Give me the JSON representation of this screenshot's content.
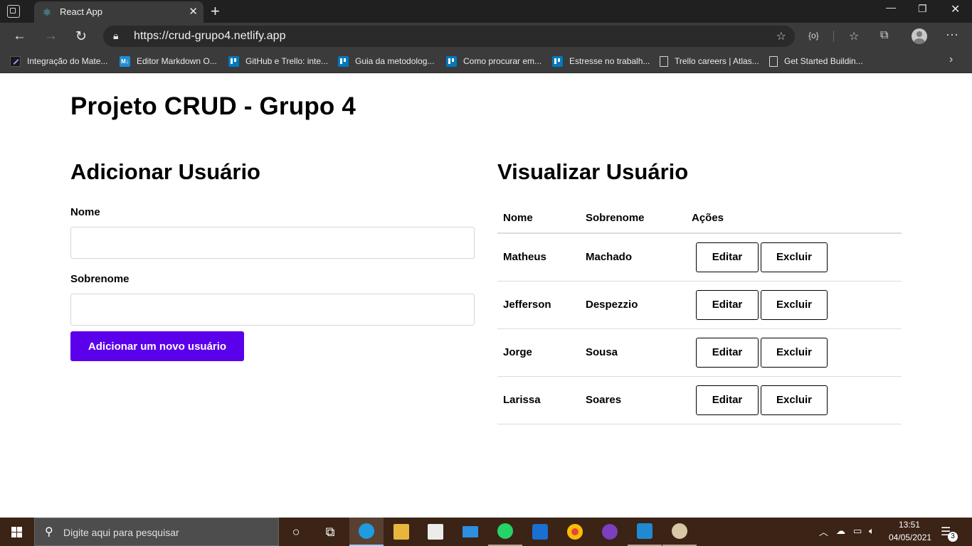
{
  "browser": {
    "tab_title": "React App",
    "url": "https://crud-grupo4.netlify.app",
    "bookmarks": [
      {
        "label": "Integração do Mate...",
        "icon": "mate-icon"
      },
      {
        "label": "Editor Markdown O...",
        "icon": "markdown-icon"
      },
      {
        "label": "GitHub e Trello: inte...",
        "icon": "trello-icon"
      },
      {
        "label": "Guia da metodolog...",
        "icon": "trello-icon"
      },
      {
        "label": "Como procurar em...",
        "icon": "trello-icon"
      },
      {
        "label": "Estresse no trabalh...",
        "icon": "trello-icon"
      },
      {
        "label": "Trello careers | Atlas...",
        "icon": "page-icon"
      },
      {
        "label": "Get Started Buildin...",
        "icon": "page-icon"
      }
    ]
  },
  "page": {
    "title": "Projeto CRUD - Grupo 4",
    "add_section": {
      "title": "Adicionar Usuário",
      "nome_label": "Nome",
      "nome_value": "",
      "sobrenome_label": "Sobrenome",
      "sobrenome_value": "",
      "submit_label": "Adicionar um novo usuário"
    },
    "view_section": {
      "title": "Visualizar Usuário",
      "columns": [
        "Nome",
        "Sobrenome",
        "Ações"
      ],
      "rows": [
        {
          "nome": "Matheus",
          "sobrenome": "Machado"
        },
        {
          "nome": "Jefferson",
          "sobrenome": "Despezzio"
        },
        {
          "nome": "Jorge",
          "sobrenome": "Sousa"
        },
        {
          "nome": "Larissa",
          "sobrenome": "Soares"
        }
      ],
      "edit_label": "Editar",
      "delete_label": "Excluir"
    }
  },
  "taskbar": {
    "search_placeholder": "Digite aqui para pesquisar",
    "time": "13:51",
    "date": "04/05/2021",
    "notification_count": "3"
  },
  "colors": {
    "accent_button": "#5b00eb",
    "taskbar": "#3b2316",
    "browser_chrome": "#3b3b3b"
  }
}
